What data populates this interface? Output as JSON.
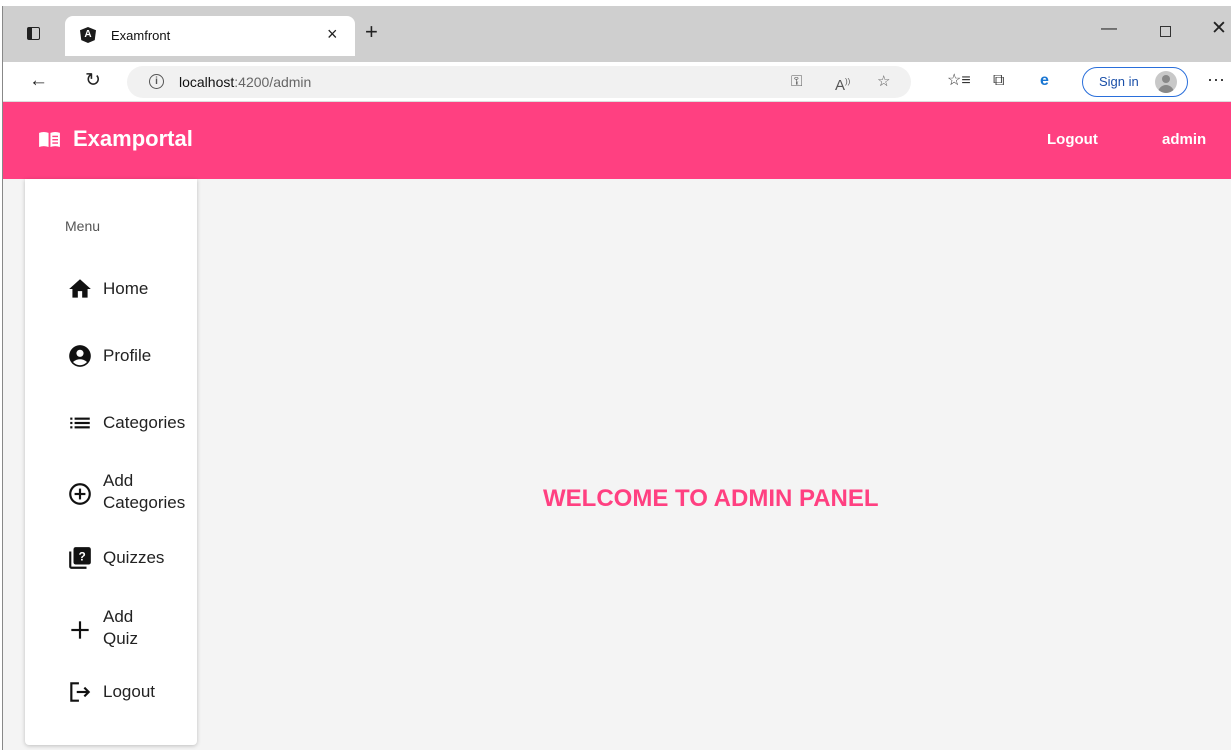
{
  "browser": {
    "tab_title": "Examfront",
    "tab_close": "×",
    "new_tab": "+",
    "url_host": "localhost",
    "url_path": ":4200/admin",
    "sign_in": "Sign in",
    "more": "···"
  },
  "toolbar": {
    "brand": "Examportal",
    "logout": "Logout",
    "user": "admin"
  },
  "sidebar": {
    "heading": "Menu",
    "items": [
      {
        "label": "Home",
        "icon": "home-icon"
      },
      {
        "label": "Profile",
        "icon": "account-circle-icon"
      },
      {
        "label": "Categories",
        "icon": "list-icon"
      },
      {
        "label": "Add Categories",
        "icon": "add-circle-icon"
      },
      {
        "label": "Quizzes",
        "icon": "quiz-icon"
      },
      {
        "label": "Add Quiz",
        "icon": "add-icon"
      },
      {
        "label": "Logout",
        "icon": "logout-icon"
      }
    ]
  },
  "main": {
    "welcome": "WELCOME TO ADMIN PANEL"
  },
  "colors": {
    "accent": "#ff4081",
    "background": "#f4f4f4"
  }
}
